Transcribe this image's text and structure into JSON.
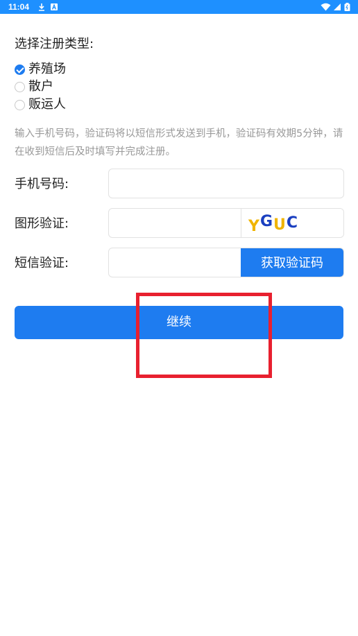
{
  "status_bar": {
    "time": "11:04",
    "background": "#1e90ff",
    "icons": [
      "download-icon",
      "notification-a-icon",
      "wifi-icon",
      "signal-icon",
      "battery-icon"
    ]
  },
  "registration": {
    "type_title": "选择注册类型:",
    "types": [
      {
        "label": "养殖场",
        "checked": true
      },
      {
        "label": "散户",
        "checked": false
      },
      {
        "label": "贩运人",
        "checked": false
      }
    ]
  },
  "hint": "输入手机号码，验证码将以短信形式发送到手机，验证码有效期5分钟，请在收到短信后及时填写并完成注册。",
  "form": {
    "phone_label": "手机号码:",
    "phone_value": "",
    "captcha_label": "图形验证:",
    "captcha_value": "",
    "captcha_text": "YGUC",
    "sms_label": "短信验证:",
    "sms_value": "",
    "sms_button": "获取验证码"
  },
  "continue_button": "继续",
  "colors": {
    "accent": "#1e7cf0",
    "highlight": "#e8202f",
    "captcha_yellow": "#f0b400",
    "captcha_blue": "#1a3fc0"
  }
}
